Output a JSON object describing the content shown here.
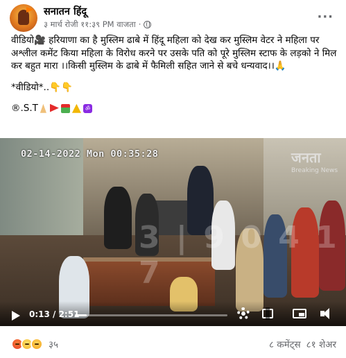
{
  "header": {
    "page_name": "सनातन हिंदू",
    "timestamp": "३ मार्च रोजी ११:३९ PM वाजता",
    "separator": "·",
    "more_label": "···"
  },
  "post": {
    "text_main": "वीडियो🎥 हरियाणा का है मुस्लिम ढाबे में हिंदू महिला को देख कर मुस्लिम वेटर ने महिला पर अश्लील कमेंट किया महिला के विरोध करने पर उसके पति को पूरे मुस्लिम स्टाफ के लड़को ने मिल कर बहुत मारा ।।किसी मुस्लिम के ढाबे में फैमिली सहित जाने से बचे धन्यवाद।।🙏",
    "text_video": "*वीडियो*..👇👇",
    "signature": "®.S.T",
    "signature_om": "ॐ"
  },
  "video": {
    "cctv_timestamp": "02-14-2022 Mon 00:35:28",
    "watermark": "जनता",
    "watermark_sub": "Breaking News",
    "faint_overlay": "3 | 9 0 4 1 7",
    "current_time": "0:13 / 2:51",
    "progress": 0.077
  },
  "footer": {
    "reaction_count": "३५",
    "comments": "८ कमेंट्स",
    "shares": "८१ शेअर"
  },
  "colors": {
    "text": "#050505",
    "meta": "#65676b",
    "angry": "#e7422a",
    "sad": "#f6b22d"
  }
}
